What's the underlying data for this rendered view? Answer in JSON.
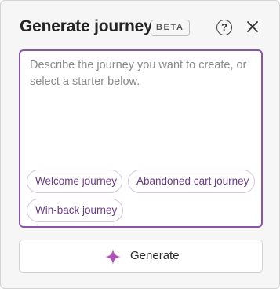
{
  "header": {
    "title": "Generate journey",
    "badge": "BETA",
    "help_icon": "question-circle-icon",
    "close_icon": "close-icon"
  },
  "prompt": {
    "placeholder": "Describe the journey you want to create, or select a starter below.",
    "starters": [
      "Welcome journey",
      "Abandoned cart journey",
      "Win-back journey"
    ]
  },
  "footer": {
    "generate_label": "Generate",
    "generate_icon": "sparkle-icon"
  },
  "colors": {
    "accent": "#8a55a9",
    "chip_text": "#6a3b86",
    "sparkle": "#b24fb6"
  }
}
